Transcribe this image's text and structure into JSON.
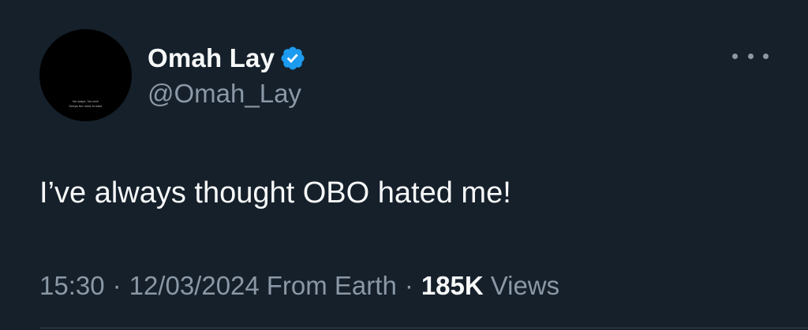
{
  "author": {
    "display_name": "Omah Lay",
    "handle": "@Omah_Lay",
    "verified_icon": "verified-badge-icon",
    "avatar_caption": [
      "No swipe, No rest!",
      "Keeps the mind at ease"
    ]
  },
  "menu": {
    "icon": "more-options-icon"
  },
  "tweet": {
    "text": "I’ve always thought OBO hated me!"
  },
  "meta": {
    "time": "15:30",
    "separator": "·",
    "date": "12/03/2024",
    "source": "From Earth",
    "views_count": "185K",
    "views_label": "Views"
  },
  "colors": {
    "background": "#15202b",
    "primary_text": "#f7f9f9",
    "secondary_text": "#8b98a5",
    "verified_blue": "#1d9bf0"
  }
}
